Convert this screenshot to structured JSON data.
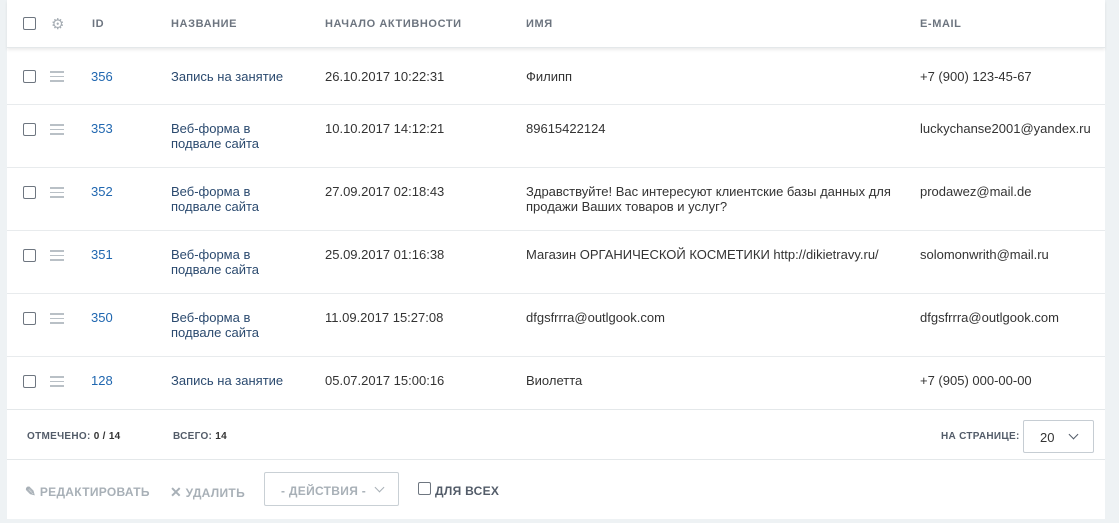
{
  "header": {
    "id": "ID",
    "name": "НАЗВАНИЕ",
    "start": "НАЧАЛО АКТИВНОСТИ",
    "person": "ИМЯ",
    "email": "E-MAIL"
  },
  "rows": [
    {
      "id": "356",
      "name": "Запись на занятие",
      "start": "26.10.2017 10:22:31",
      "person": "Филипп",
      "email": "+7 (900) 123-45-67"
    },
    {
      "id": "353",
      "name": "Веб-форма в подвале сайта",
      "start": "10.10.2017 14:12:21",
      "person": "89615422124",
      "email": "luckychanse2001@yandex.ru"
    },
    {
      "id": "352",
      "name": "Веб-форма в подвале сайта",
      "start": "27.09.2017 02:18:43",
      "person": "Здравствуйте! Вас интересуют клиентские базы данных для продажи Ваших товаров и услуг?",
      "email": "prodawez@mail.de"
    },
    {
      "id": "351",
      "name": "Веб-форма в подвале сайта",
      "start": "25.09.2017 01:16:38",
      "person": "Магазин ОРГАНИЧЕСКОЙ КОСМЕТИКИ http://dikietravy.ru/",
      "email": "solomonwrith@mail.ru"
    },
    {
      "id": "350",
      "name": "Веб-форма в подвале сайта",
      "start": "11.09.2017 15:27:08",
      "person": "dfgsfrrra@outlgook.com",
      "email": "dfgsfrrra@outlgook.com"
    },
    {
      "id": "128",
      "name": "Запись на занятие",
      "start": "05.07.2017 15:00:16",
      "person": "Виолетта",
      "email": "+7 (905) 000-00-00"
    }
  ],
  "footer": {
    "checked_label": "ОТМЕЧЕНО:",
    "checked_value": "0 / 14",
    "total_label": "ВСЕГО:",
    "total_value": "14",
    "per_page_label": "НА СТРАНИЦЕ:",
    "per_page_value": "20"
  },
  "actions": {
    "edit": "РЕДАКТИРОВАТЬ",
    "delete": "УДАЛИТЬ",
    "actions_select": "- ДЕЙСТВИЯ -",
    "for_all": "ДЛЯ ВСЕХ"
  }
}
